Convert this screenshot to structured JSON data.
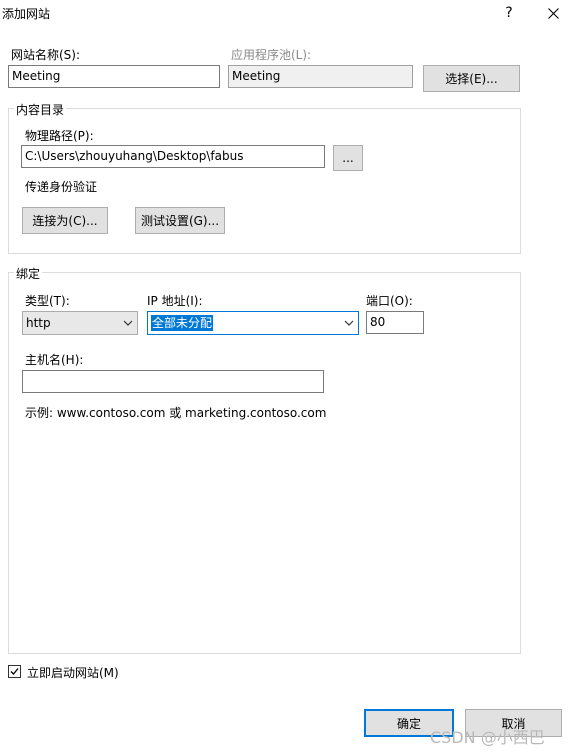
{
  "window": {
    "title": "添加网站",
    "help_glyph": "?",
    "close_glyph": "✕"
  },
  "site": {
    "name_label": "网站名称(S):",
    "name_value": "Meeting",
    "pool_label": "应用程序池(L):",
    "pool_value": "Meeting",
    "select_button": "选择(E)..."
  },
  "content_dir": {
    "group_title": "内容目录",
    "physical_path_label": "物理路径(P):",
    "physical_path_value": "C:\\Users\\zhouyuhang\\Desktop\\fabus",
    "browse_button": "...",
    "pass_through_label": "传递身份验证",
    "connect_as_button": "连接为(C)...",
    "test_settings_button": "测试设置(G)..."
  },
  "binding": {
    "group_title": "绑定",
    "type_label": "类型(T):",
    "type_value": "http",
    "ip_label": "IP 地址(I):",
    "ip_value": "全部未分配",
    "port_label": "端口(O):",
    "port_value": "80",
    "host_label": "主机名(H):",
    "host_value": "",
    "example_text": "示例: www.contoso.com 或 marketing.contoso.com"
  },
  "footer": {
    "start_immediately_label": "立即启动网站(M)",
    "start_immediately_checked": true,
    "ok_button": "确定",
    "cancel_button": "取消",
    "watermark": "CSDN @小西巴"
  },
  "colors": {
    "accent": "#0078d7",
    "button_bg": "#e1e1e1",
    "readonly_bg": "#f0f0f0"
  }
}
